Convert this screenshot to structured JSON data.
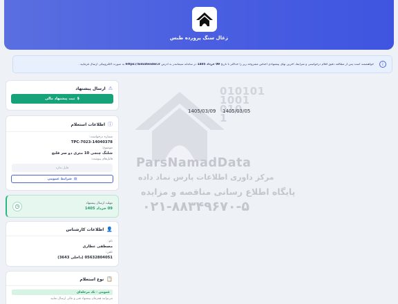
{
  "header": {
    "title": "زغال سنگ پرورده طبس"
  },
  "notice": {
    "text_before_date": "خواهشمند است پس از مطالعه دقیق اقلام درخواستی و شرایط، آخرین بهای پیشنهادی اجناس مشروحه زیر را حداکثر تا تاریخ",
    "date": "09 خرداد 1405",
    "text_middle": "در سامانه سیمانتدر به آدرس",
    "address": "https://Simatender.ir",
    "text_after": "به صورت الکترونیکی ارسال فرمایید ."
  },
  "send_offer": {
    "title": "ارسال پیشنهاد",
    "button": "ثبت پیشنهاد مالی"
  },
  "inquiry": {
    "title": "اطلاعات استعلام",
    "number_label": "شماره درخواست:",
    "number_value": "TPC-7023-14040378",
    "subject_label": "موضوع:",
    "subject_value": "شلنگ چنجی 10 متری دو سر فلنج",
    "attachments_label": "فایل‌های پیوست:",
    "attachments_empty": "فایل ندارد",
    "terms_button": "شرایط عمومی"
  },
  "deadline": {
    "label": "مهلت ارسال پیشنهاد",
    "value": "09 خرداد 1405"
  },
  "expert": {
    "title": "اطلاعات کارشناس",
    "name_label": "نام:",
    "name_value": "مصطفی عطاری",
    "phone_label": "تلفن:",
    "phone_value": "05632804051 (داخلی 3643)"
  },
  "inquiry_type": {
    "title": "نوع استعلام",
    "tag": "عمومی - تک مرحله‌ای",
    "description": "می‌توانید همزمان پیشنهاد فنی و مالی ارسال نمایید"
  },
  "dates": {
    "left": "1405/03/09",
    "right": "1405/03/05"
  },
  "watermark": {
    "digits": [
      "010101",
      "1001",
      "010",
      "1"
    ],
    "brand": "ParsNamadData",
    "line1": "مرکز داوری اطلاعات پارس نماد داده",
    "line2": "پایگاه اطلاع رسانی مناقصه و مزایده",
    "phone": "۰۲۱-۸۸۳۴۹۶۷۰-۵"
  },
  "colors": {
    "header": "#4a5fe0",
    "green": "#17a37a",
    "accent": "#4a64d8"
  }
}
